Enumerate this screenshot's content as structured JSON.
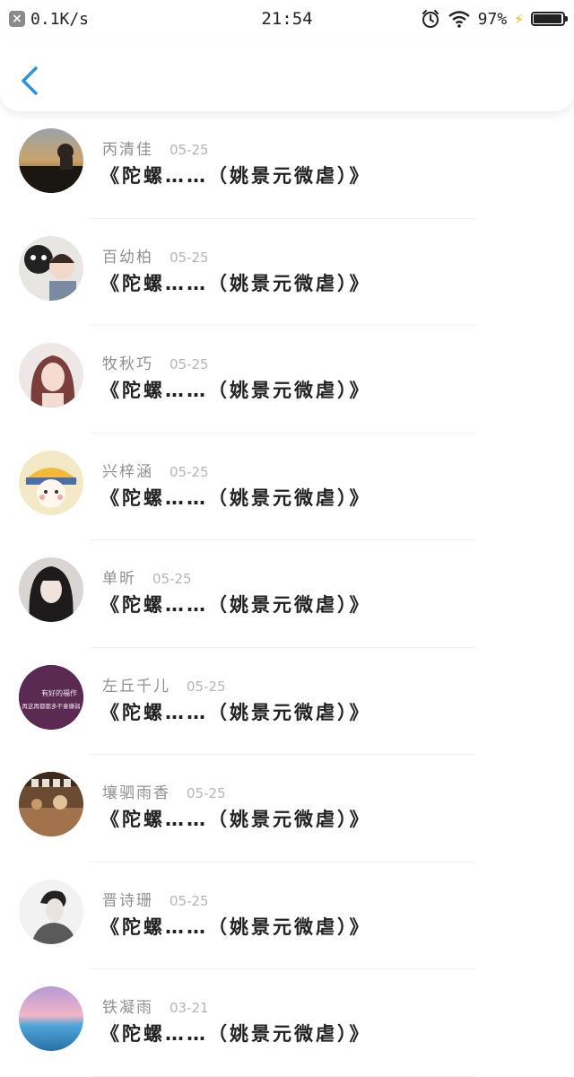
{
  "status_bar": {
    "network_speed": "0.1K/s",
    "time": "21:54",
    "battery_percent": "97%",
    "battery_level": 0.97
  },
  "header": {
    "back_icon": "chevron-left-icon",
    "accent_color": "#2f8fe0"
  },
  "items": [
    {
      "name": "丙清佳",
      "date": "05-25",
      "title": "《陀螺……（姚景元微虐）》"
    },
    {
      "name": "百幼柏",
      "date": "05-25",
      "title": "《陀螺……（姚景元微虐）》"
    },
    {
      "name": "牧秋巧",
      "date": "05-25",
      "title": "《陀螺……（姚景元微虐）》"
    },
    {
      "name": "兴梓涵",
      "date": "05-25",
      "title": "《陀螺……（姚景元微虐）》"
    },
    {
      "name": "单昕",
      "date": "05-25",
      "title": "《陀螺……（姚景元微虐）》"
    },
    {
      "name": "左丘千儿",
      "date": "05-25",
      "title": "《陀螺……（姚景元微虐）》",
      "avatar_text": [
        "有好的福作",
        "再这再都都多不會嫌弱"
      ]
    },
    {
      "name": "壤驷雨香",
      "date": "05-25",
      "title": "《陀螺……（姚景元微虐）》"
    },
    {
      "name": "晋诗珊",
      "date": "05-25",
      "title": "《陀螺……（姚景元微虐）》"
    },
    {
      "name": "铁凝雨",
      "date": "03-21",
      "title": "《陀螺……（姚景元微虐）》"
    }
  ]
}
